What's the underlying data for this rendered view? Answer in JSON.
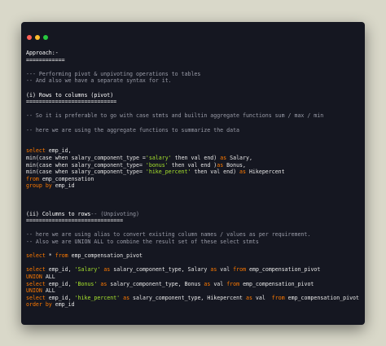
{
  "colors": {
    "background": "#d9d8c9",
    "editor_bg": "#151721",
    "dot_close": "#ff5f56",
    "dot_min": "#ffbd2e",
    "dot_max": "#27c93f",
    "keyword": "#ff7a00",
    "string": "#a6e22e",
    "comment": "#9a9ca8",
    "text": "#e6e6e6"
  },
  "window_controls": [
    "close-dot",
    "minimize-dot",
    "maximize-dot"
  ],
  "lines": [
    [
      {
        "t": "Approach:-",
        "c": "head"
      }
    ],
    [
      {
        "t": "============",
        "c": "head"
      }
    ],
    [],
    [
      {
        "t": "--- Performing pivot & unpivoting operations to tables",
        "c": "comment"
      }
    ],
    [
      {
        "t": "-- And also we have a separate syntax for it.",
        "c": "comment"
      }
    ],
    [],
    [
      {
        "t": "(i) Rows to columns (pivot)",
        "c": "head"
      }
    ],
    [
      {
        "t": "============================",
        "c": "head"
      }
    ],
    [],
    [
      {
        "t": "-- So it is preferable to go with case stmts and builtin aggregate functions sum / max / min",
        "c": "comment"
      }
    ],
    [],
    [
      {
        "t": "-- here we are using the aggregate functions to summarize the data",
        "c": "comment"
      }
    ],
    [],
    [],
    [
      {
        "t": "select",
        "c": "kw"
      },
      {
        "t": " emp_id,",
        "c": "text"
      }
    ],
    [
      {
        "t": "min(case when salary_component_type =",
        "c": "text"
      },
      {
        "t": "'salary'",
        "c": "str"
      },
      {
        "t": " then val end) ",
        "c": "text"
      },
      {
        "t": "as",
        "c": "kw"
      },
      {
        "t": " Salary,",
        "c": "text"
      }
    ],
    [
      {
        "t": "min(case when salary_component_type= ",
        "c": "text"
      },
      {
        "t": "'bonus'",
        "c": "str"
      },
      {
        "t": " then val end )",
        "c": "text"
      },
      {
        "t": "as",
        "c": "kw"
      },
      {
        "t": " Bonus,",
        "c": "text"
      }
    ],
    [
      {
        "t": "min(case when salary_component_type= ",
        "c": "text"
      },
      {
        "t": "'hike_percent'",
        "c": "str"
      },
      {
        "t": " then val end) ",
        "c": "text"
      },
      {
        "t": "as",
        "c": "kw"
      },
      {
        "t": " Hikepercent",
        "c": "text"
      }
    ],
    [
      {
        "t": "from",
        "c": "kw"
      },
      {
        "t": " emp_compensation",
        "c": "text"
      }
    ],
    [
      {
        "t": "group by",
        "c": "kw"
      },
      {
        "t": " emp_id",
        "c": "text"
      }
    ],
    [],
    [],
    [],
    [
      {
        "t": "(ii) Columns to rows",
        "c": "head"
      },
      {
        "t": "-- (Unpivoting)",
        "c": "comment"
      }
    ],
    [
      {
        "t": "==============================",
        "c": "head"
      }
    ],
    [],
    [
      {
        "t": "-- here we are using alias to convert existing column names / values as per requirement.",
        "c": "comment"
      }
    ],
    [
      {
        "t": "-- Also we are UNION ALL to combine the result set of these select stmts",
        "c": "comment"
      }
    ],
    [],
    [
      {
        "t": "select",
        "c": "kw"
      },
      {
        "t": " * ",
        "c": "text"
      },
      {
        "t": "from",
        "c": "kw"
      },
      {
        "t": " emp_compensation_pivot",
        "c": "text"
      }
    ],
    [],
    [
      {
        "t": "select",
        "c": "kw"
      },
      {
        "t": " emp_id, ",
        "c": "text"
      },
      {
        "t": "'Salary'",
        "c": "str"
      },
      {
        "t": " ",
        "c": "text"
      },
      {
        "t": "as",
        "c": "kw"
      },
      {
        "t": " salary_component_type, Salary ",
        "c": "text"
      },
      {
        "t": "as",
        "c": "kw"
      },
      {
        "t": " val ",
        "c": "text"
      },
      {
        "t": "from",
        "c": "kw"
      },
      {
        "t": " emp_compensation_pivot",
        "c": "text"
      }
    ],
    [
      {
        "t": "UNION",
        "c": "kw"
      },
      {
        "t": " ALL",
        "c": "text"
      }
    ],
    [
      {
        "t": "select",
        "c": "kw"
      },
      {
        "t": " emp_id, ",
        "c": "text"
      },
      {
        "t": "'Bonus'",
        "c": "str"
      },
      {
        "t": " ",
        "c": "text"
      },
      {
        "t": "as",
        "c": "kw"
      },
      {
        "t": " salary_component_type, Bonus ",
        "c": "text"
      },
      {
        "t": "as",
        "c": "kw"
      },
      {
        "t": " val ",
        "c": "text"
      },
      {
        "t": "from",
        "c": "kw"
      },
      {
        "t": " emp_compensation_pivot",
        "c": "text"
      }
    ],
    [
      {
        "t": "UNION",
        "c": "kw"
      },
      {
        "t": " ALL",
        "c": "text"
      }
    ],
    [
      {
        "t": "select",
        "c": "kw"
      },
      {
        "t": " emp_id, ",
        "c": "text"
      },
      {
        "t": "'hike_percent'",
        "c": "str"
      },
      {
        "t": " ",
        "c": "text"
      },
      {
        "t": "as",
        "c": "kw"
      },
      {
        "t": " salary_component_type, Hikepercent ",
        "c": "text"
      },
      {
        "t": "as",
        "c": "kw"
      },
      {
        "t": " val  ",
        "c": "text"
      },
      {
        "t": "from",
        "c": "kw"
      },
      {
        "t": " emp_compensation_pivot",
        "c": "text"
      }
    ],
    [
      {
        "t": "order by",
        "c": "kw"
      },
      {
        "t": " emp_id",
        "c": "text"
      }
    ]
  ]
}
